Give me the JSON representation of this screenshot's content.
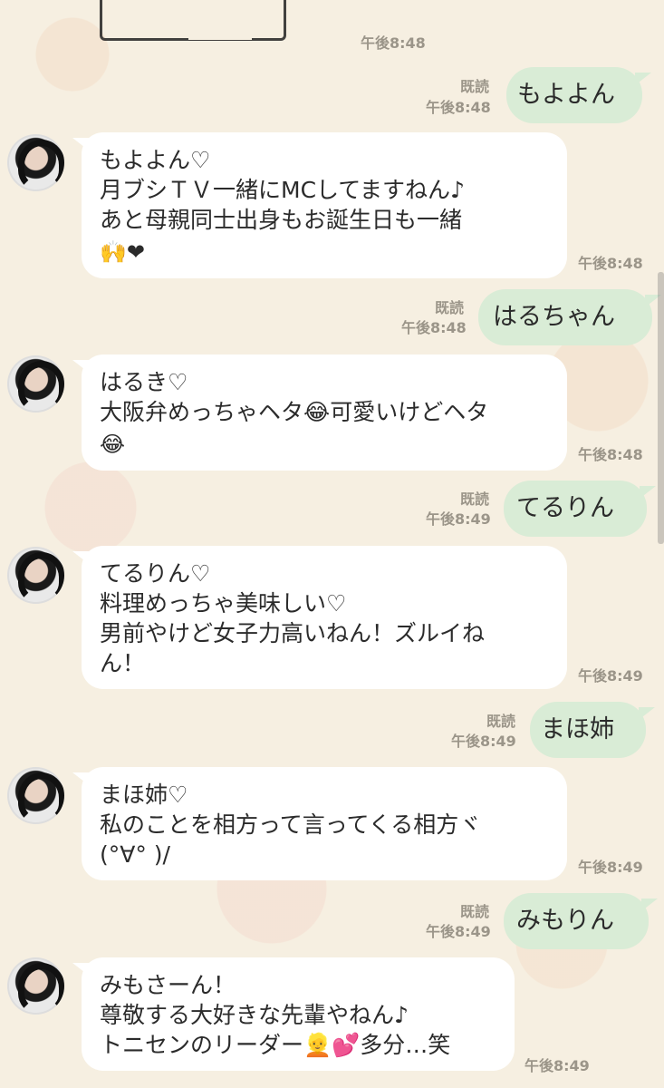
{
  "messages": [
    {
      "type": "out",
      "read": "既読",
      "time": "午後8:48",
      "text": "もよよん"
    },
    {
      "type": "in",
      "time": "午後8:48",
      "lines": [
        "もよよん♡",
        "月ブシＴＶ一緒にMCしてますねん♪",
        "あと母親同士出身もお誕生日も一緒",
        "🙌❤"
      ]
    },
    {
      "type": "out",
      "read": "既読",
      "time": "午後8:48",
      "text": "はるちゃん"
    },
    {
      "type": "in",
      "time": "午後8:48",
      "lines": [
        "はるき♡",
        "大阪弁めっちゃヘタ😂可愛いけどヘタ",
        "😂"
      ]
    },
    {
      "type": "out",
      "read": "既読",
      "time": "午後8:49",
      "text": "てるりん"
    },
    {
      "type": "in",
      "time": "午後8:49",
      "lines": [
        "てるりん♡",
        "料理めっちゃ美味しい♡",
        "男前やけど女子力高いねん！ズルイね",
        "ん！"
      ]
    },
    {
      "type": "out",
      "read": "既読",
      "time": "午後8:49",
      "text": "まほ姉"
    },
    {
      "type": "in",
      "time": "午後8:49",
      "lines": [
        "まほ姉♡",
        "私のことを相方って言ってくる相方ヾ",
        "(°∀° )/"
      ]
    },
    {
      "type": "out",
      "read": "既読",
      "time": "午後8:49",
      "text": "みもりん"
    },
    {
      "type": "in",
      "time": "午後8:49",
      "lines": [
        "みもさーん！",
        "尊敬する大好きな先輩やねん♪",
        "トニセンのリーダー👱💕多分…笑"
      ]
    }
  ],
  "top_time": "午後8:48"
}
